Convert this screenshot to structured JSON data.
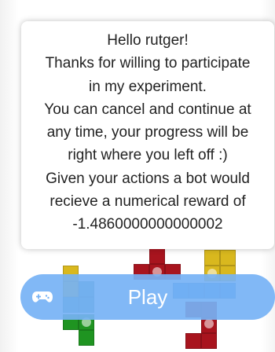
{
  "greeting": {
    "lines": [
      "Hello rutger!",
      "Thanks for willing to participate",
      "in my experiment.",
      "You can cancel and continue at",
      "any time, your progress will be",
      "right where you left off :)",
      "Given your actions a bot would",
      "recieve a numerical reward of",
      "-1.4860000000000002"
    ]
  },
  "play_button": {
    "label": "Play",
    "icon": "gamepad-icon",
    "color": "#76b2f5"
  },
  "colors": {
    "yellow": "#d9b81e",
    "teal": "#3e9a9a",
    "green": "#1f9421",
    "red": "#a8141e",
    "light_green": "#7cc47c",
    "blue": "#2f8ee6"
  }
}
